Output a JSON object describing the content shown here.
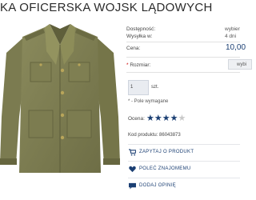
{
  "product": {
    "title": "KA OFICERSKA WOJSK LĄDOWYCH",
    "image_alt": "olive officer uniform jacket"
  },
  "details": {
    "availability_label": "Dostępność:",
    "availability_value": "wybier",
    "shipping_label": "Wysyłka w:",
    "shipping_value": "4 dni",
    "price_label": "Cena:",
    "price_value": "10,00",
    "size_label": "Rozmiar:",
    "size_required_mark": "*",
    "size_select_value": "wybi"
  },
  "quantity": {
    "value": "1",
    "unit": "szt."
  },
  "required_note": "* - Pole wymagane",
  "rating": {
    "label": "Ocena:",
    "stars_filled": 4,
    "stars_total": 5
  },
  "product_code": "Kod produktu: 86043873",
  "actions": {
    "ask": "ZAPYTAJ O PRODUKT",
    "recommend": "POLEĆ ZNAJOMEMU",
    "review": "DODAJ OPINIĘ"
  },
  "colors": {
    "accent": "#1b3f73",
    "star": "#1b3f73",
    "star_empty": "#c9c9c9"
  }
}
